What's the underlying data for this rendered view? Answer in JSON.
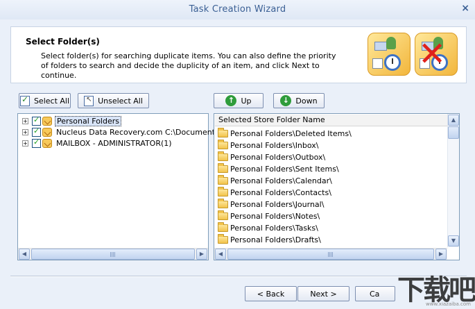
{
  "window": {
    "title": "Task Creation Wizard",
    "close_glyph": "×"
  },
  "header": {
    "title": "Select Folder(s)",
    "description": "Select folder(s) for searching duplicate items. You can also define the priority of folders to search and decide the duplicity of an item, and click Next to continue."
  },
  "toolbar": {
    "select_all": "Select All",
    "unselect_all": "Unselect All",
    "up": "Up",
    "down": "Down"
  },
  "tree": {
    "items": [
      {
        "label": "Personal Folders",
        "checked": true,
        "selected": true
      },
      {
        "label": "Nucleus Data Recovery.com C:\\Documents",
        "checked": true,
        "selected": false
      },
      {
        "label": "MAILBOX - ADMINISTRATOR(1)",
        "checked": true,
        "selected": false
      }
    ]
  },
  "store_list": {
    "column_header": "Selected Store Folder Name",
    "rows": [
      "Personal Folders\\Deleted Items\\",
      "Personal Folders\\Inbox\\",
      "Personal Folders\\Outbox\\",
      "Personal Folders\\Sent Items\\",
      "Personal Folders\\Calendar\\",
      "Personal Folders\\Contacts\\",
      "Personal Folders\\Journal\\",
      "Personal Folders\\Notes\\",
      "Personal Folders\\Tasks\\",
      "Personal Folders\\Drafts\\"
    ]
  },
  "footer": {
    "back": "< Back",
    "next": "Next >",
    "cancel": "Ca"
  },
  "watermark": {
    "brand": "下载吧",
    "url": "www.xiazaiba.com"
  },
  "colors": {
    "title_text": "#3a5f94",
    "accent": "#7f9db9",
    "background": "#eaf0f9"
  }
}
